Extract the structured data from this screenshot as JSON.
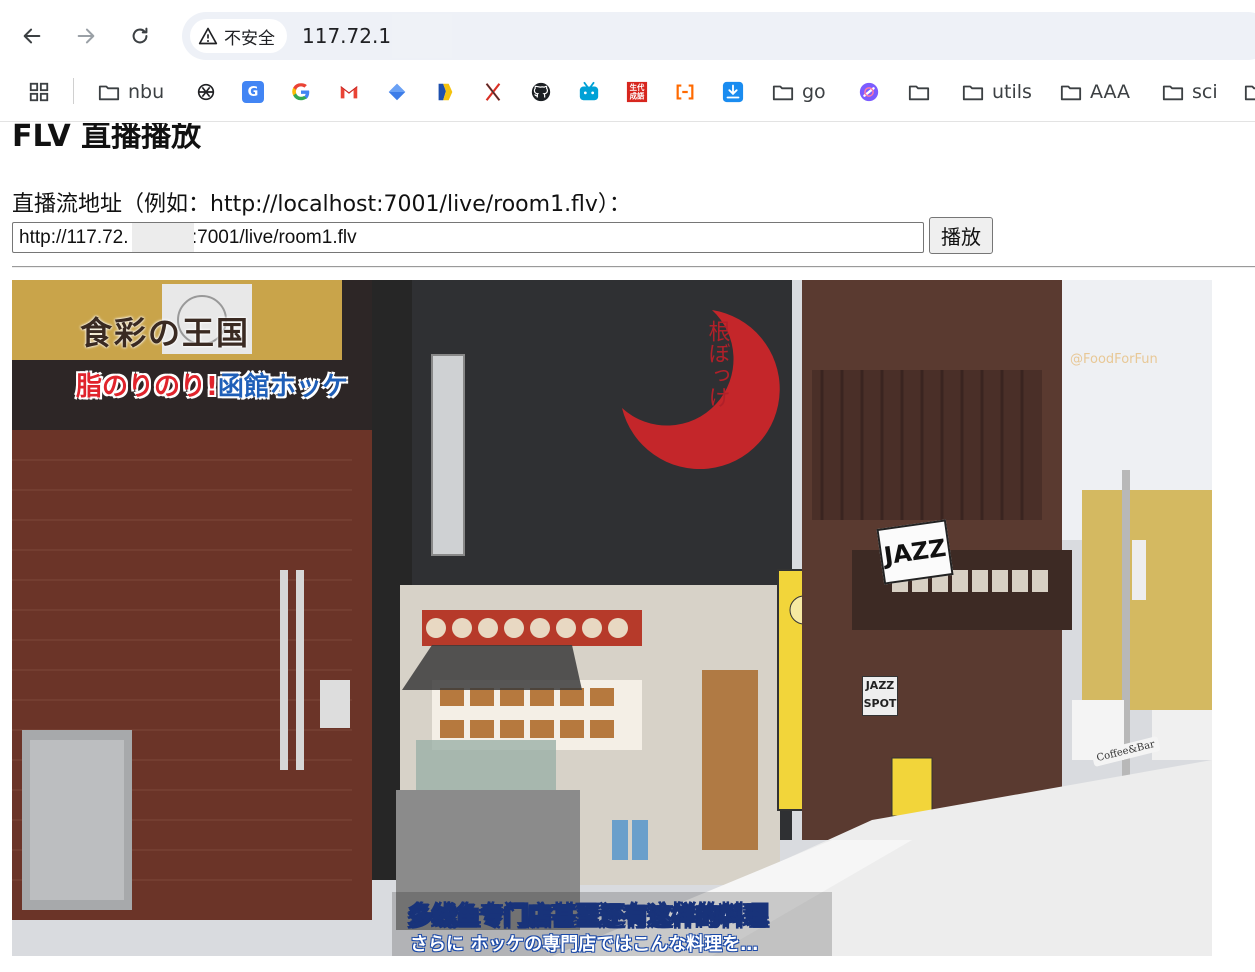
{
  "browser": {
    "security_label": "不安全",
    "url": "117.72.1",
    "bookmarks": [
      {
        "label": "nbu",
        "icon": "folder-icon"
      },
      {
        "label": "",
        "icon": "chatgpt-icon"
      },
      {
        "label": "",
        "icon": "translate-icon"
      },
      {
        "label": "",
        "icon": "google-icon"
      },
      {
        "label": "",
        "icon": "gmail-icon"
      },
      {
        "label": "",
        "icon": "diamond-icon"
      },
      {
        "label": "",
        "icon": "yellow-flag-icon"
      },
      {
        "label": "",
        "icon": "x-cross-icon"
      },
      {
        "label": "",
        "icon": "github-icon"
      },
      {
        "label": "",
        "icon": "bilibili-icon"
      },
      {
        "label": "",
        "icon": "red-square-icon"
      },
      {
        "label": "",
        "icon": "orange-bracket-icon"
      },
      {
        "label": "",
        "icon": "download-icon"
      },
      {
        "label": "go",
        "icon": "folder-icon"
      },
      {
        "label": "",
        "icon": "purple-circle-icon"
      },
      {
        "label": "",
        "icon": "folder-icon"
      },
      {
        "label": "utils",
        "icon": "folder-icon"
      },
      {
        "label": "AAA",
        "icon": "folder-icon"
      },
      {
        "label": "sci",
        "icon": "folder-icon"
      }
    ],
    "red_square_text": "生代\n成語"
  },
  "page": {
    "title": "FLV 直播播放",
    "stream_label": "直播流地址（例如：http://localhost:7001/live/room1.flv）：",
    "stream_input_value": "http://117.72.            :7001/live/room1.flv",
    "play_button": "播放"
  },
  "video": {
    "title_line1": "食彩の王国",
    "title_line2_red": "脂のりのり!",
    "title_line2_blue": "函館ホッケ",
    "watermark": "@FoodForFun",
    "subtitle_zh": "多线鱼专门店甚至还有这样的料理",
    "subtitle_jp": "さらに ホッケの専門店ではこんな料理を…",
    "sign_jazz": "JAZZ",
    "sign_jazz_spot": "JAZZ SPOT",
    "sign_coffee": "Coffee&Bar",
    "colors": {
      "wall_brick": "#6b3428",
      "building_dark": "#2f3033",
      "moon_red": "#c4262a",
      "sign_yellow": "#f2d53a",
      "snow": "#ededed"
    }
  }
}
